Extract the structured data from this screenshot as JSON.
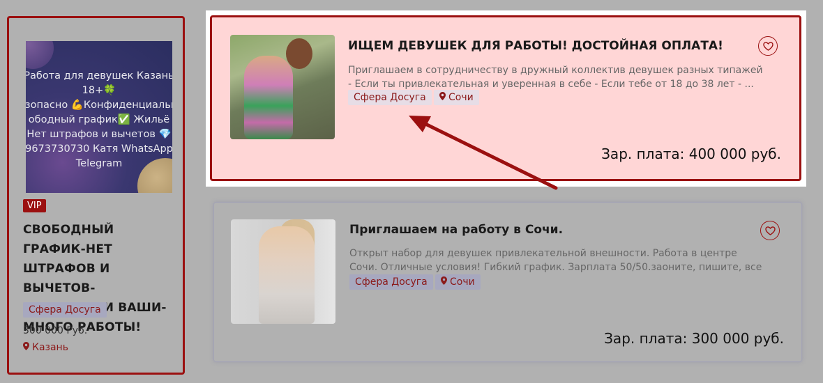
{
  "sidebar_card": {
    "image_text": "Работа для девушек Казань\n18+🍀\nезопасно 💪Конфиденциально\nободный график✅ Жильё\nНет штрафов и вычетов 💎\n9673730730 Катя WhatsApp\nTelegram",
    "badge": "VIP",
    "title": "СВОБОДНЫЙ ГРАФИК-НЕТ ШТРАФОВ И ВЫЧЕТОВ-ДОП.УСЛУГИ ВАШИ-МНОГО РАБОТЫ!",
    "tag": "Сфера Досуга",
    "salary": "300 000 Руб.",
    "city": "Казань"
  },
  "listings": [
    {
      "title": "ИЩЕМ ДЕВУШЕК ДЛЯ РАБОТЫ! ДОСТОЙНАЯ ОПЛАТА!",
      "description": "Приглашаем в сотрудничеству в дружный коллектив девушек разных типажей - Если ты привлекательная и уверенная в себе - Если тебе от 18 до 38 лет - ...",
      "tag_category": "Сфера Досуга",
      "tag_city": "Сочи",
      "salary": "Зар. плата: 400 000 руб."
    },
    {
      "title": "Приглашаем на работу в Сочи.",
      "description": "Открыт набор для девушек привлекательной внешности. Работа в центре Сочи. Отличные условия! Гибкий график. Зарплата 50/50.заоните, пишите, все ...",
      "tag_category": "Сфера Досуга",
      "tag_city": "Сочи",
      "salary": "Зар. плата: 300 000 руб."
    }
  ],
  "icons": {
    "favorite": "heart-icon",
    "location": "map-pin-icon",
    "annotation": "arrow-icon"
  },
  "colors": {
    "accent": "#9b1010",
    "highlight_bg": "#ffd6d6",
    "tag_text": "#8b1a1a"
  }
}
